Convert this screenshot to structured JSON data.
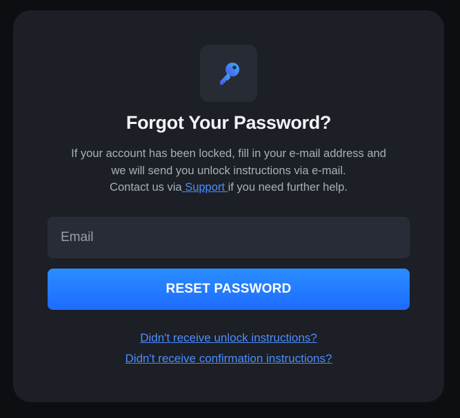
{
  "title": "Forgot Your Password?",
  "description": {
    "line1": "If your account has been locked, fill in your e-mail address and",
    "line2": "we will send you unlock instructions via e-mail.",
    "line3_prefix": "Contact us via",
    "support_link": " Support ",
    "line3_suffix": "if you need further help."
  },
  "form": {
    "email_placeholder": "Email",
    "email_value": "",
    "submit_label": "RESET PASSWORD"
  },
  "links": {
    "unlock": "Didn't receive unlock instructions?",
    "confirmation": "Didn't receive confirmation instructions?"
  },
  "icons": {
    "header_icon": "key-icon"
  },
  "colors": {
    "accent": "#4c8dff",
    "button": "#1d6bff",
    "card": "#1c1f26",
    "background": "#0d0e12"
  }
}
